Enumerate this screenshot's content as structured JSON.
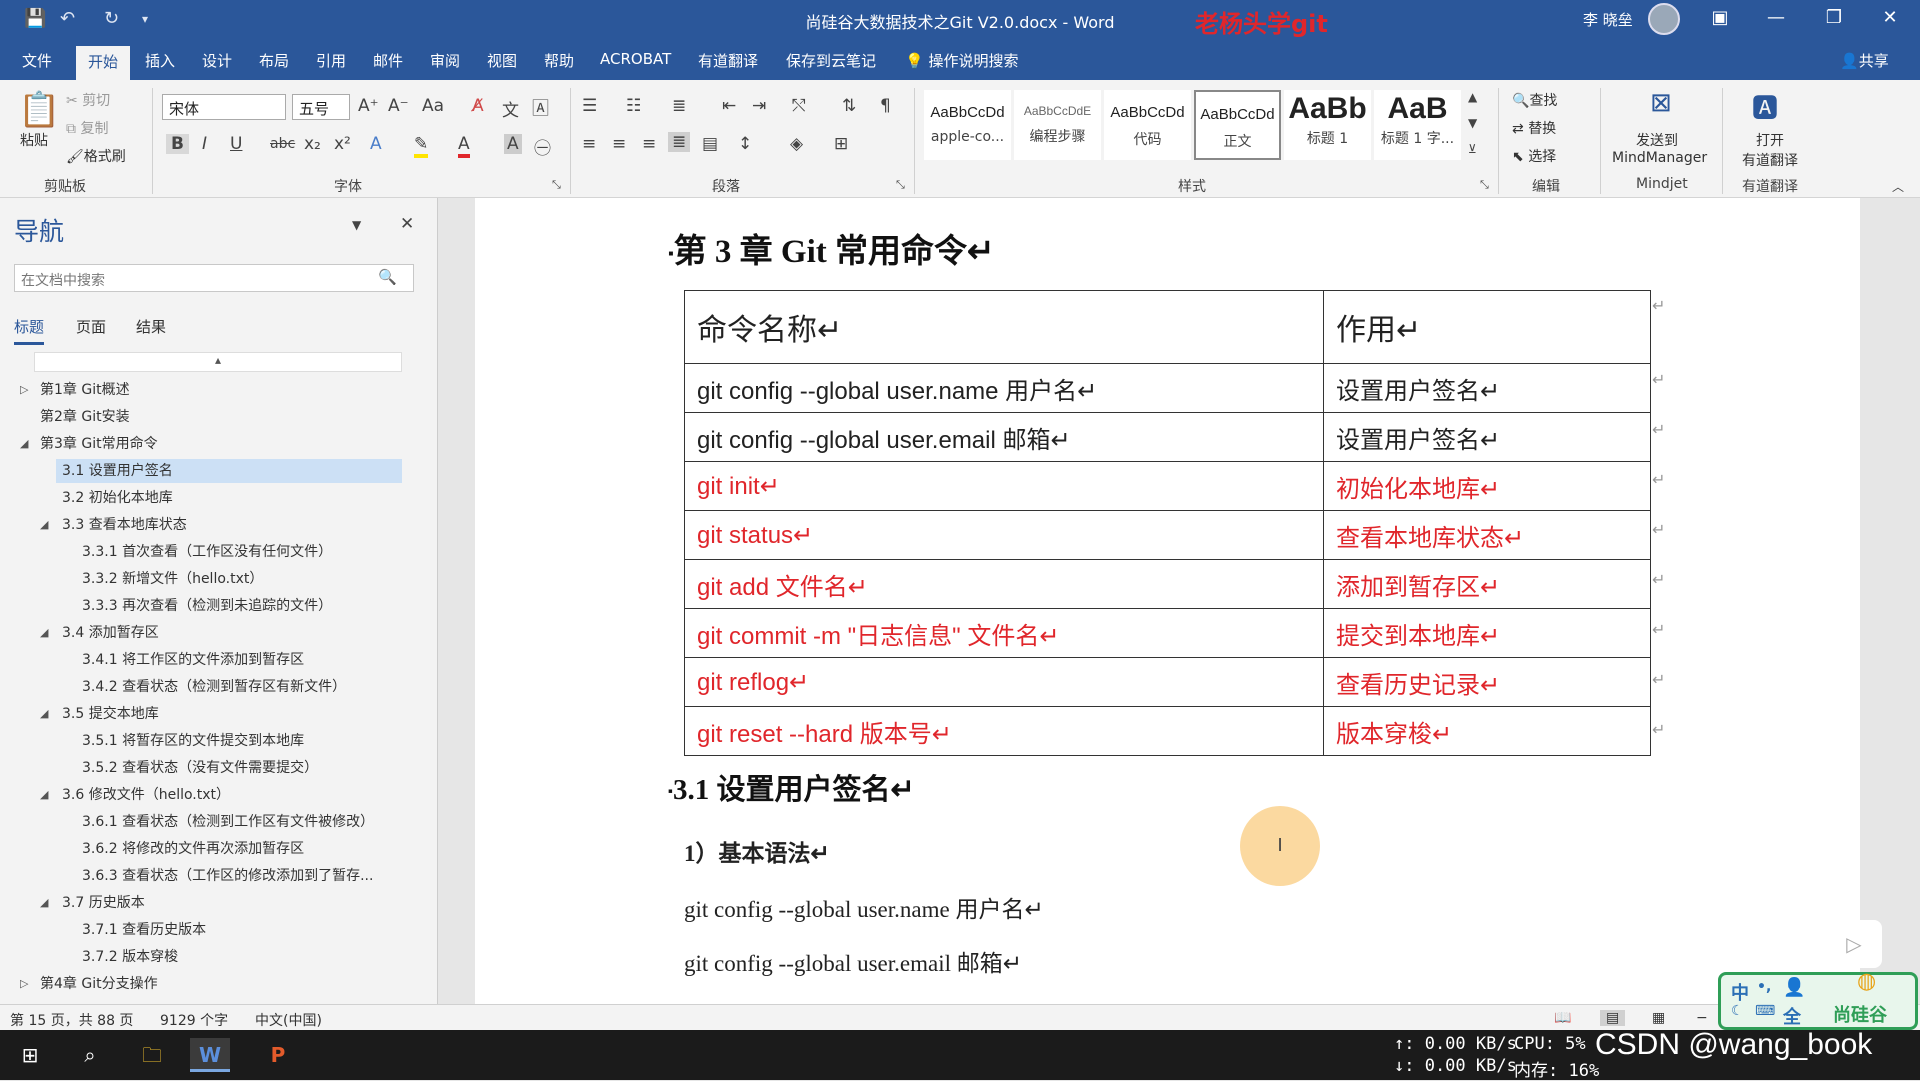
{
  "window": {
    "title": "尚硅谷大数据技术之Git V2.0.docx - Word",
    "overlay": "老杨头学git",
    "user": "李 晓垒"
  },
  "tabs": [
    "文件",
    "开始",
    "插入",
    "设计",
    "布局",
    "引用",
    "邮件",
    "审阅",
    "视图",
    "帮助",
    "ACROBAT",
    "有道翻译",
    "保存到云笔记"
  ],
  "tellme": "操作说明搜索",
  "share": "共享",
  "ribbon": {
    "clipboard": {
      "paste": "粘贴",
      "cut": "剪切",
      "copy": "复制",
      "format": "格式刷",
      "label": "剪贴板"
    },
    "font": {
      "name": "宋体",
      "size": "五号",
      "label": "字体"
    },
    "paragraph": {
      "label": "段落"
    },
    "styles": {
      "label": "样式",
      "items": [
        {
          "prev": "AaBbCcDd",
          "name": "apple-co..."
        },
        {
          "prev": "AaBbCcDdE",
          "name": "编程步骤"
        },
        {
          "prev": "AaBbCcDd",
          "name": "代码"
        },
        {
          "prev": "AaBbCcDd",
          "name": "正文"
        },
        {
          "prev": "AaBb",
          "name": "标题 1"
        },
        {
          "prev": "AaB",
          "name": "标题 1 字..."
        }
      ]
    },
    "editing": {
      "find": "查找",
      "replace": "替换",
      "select": "选择",
      "label": "编辑"
    },
    "mindjet": {
      "btn1": "发送到",
      "btn2": "MindManager",
      "label": "Mindjet"
    },
    "youdao": {
      "btn1": "打开",
      "btn2": "有道翻译",
      "label": "有道翻译"
    }
  },
  "nav": {
    "title": "导航",
    "placeholder": "在文档中搜索",
    "tabs": [
      "标题",
      "页面",
      "结果"
    ],
    "items": [
      "第1章 Git概述",
      "第2章 Git安装",
      "第3章 Git常用命令",
      "3.1 设置用户签名",
      "3.2 初始化本地库",
      "3.3 查看本地库状态",
      "3.3.1 首次查看（工作区没有任何文件）",
      "3.3.2 新增文件（hello.txt）",
      "3.3.3 再次查看（检测到未追踪的文件）",
      "3.4 添加暂存区",
      "3.4.1 将工作区的文件添加到暂存区",
      "3.4.2 查看状态（检测到暂存区有新文件）",
      "3.5 提交本地库",
      "3.5.1 将暂存区的文件提交到本地库",
      "3.5.2 查看状态（没有文件需要提交）",
      "3.6 修改文件（hello.txt）",
      "3.6.1 查看状态（检测到工作区有文件被修改）",
      "3.6.2 将修改的文件再次添加暂存区",
      "3.6.3 查看状态（工作区的修改添加到了暂存...",
      "3.7 历史版本",
      "3.7.1 查看历史版本",
      "3.7.2 版本穿梭",
      "第4章 Git分支操作"
    ]
  },
  "doc": {
    "chapter": "第 3 章  Git 常用命令↵",
    "table_header": [
      "命令名称↵",
      "作用↵"
    ],
    "rows": [
      [
        "git config --global user.name  用户名↵",
        "设置用户签名↵"
      ],
      [
        "git config --global user.email  邮箱↵",
        "设置用户签名↵"
      ],
      [
        "git init↵",
        "初始化本地库↵"
      ],
      [
        "git status↵",
        "查看本地库状态↵"
      ],
      [
        "git add  文件名↵",
        "添加到暂存区↵"
      ],
      [
        "git commit -m \"日志信息\"  文件名↵",
        "提交到本地库↵"
      ],
      [
        "git reflog↵",
        "查看历史记录↵"
      ],
      [
        "git reset --hard  版本号↵",
        "版本穿梭↵"
      ]
    ],
    "section": "3.1  设置用户签名↵",
    "syntax": "1）基本语法↵",
    "line1": "git config --global user.name  用户名↵",
    "line2": "git config --global user.email  邮箱↵"
  },
  "status": {
    "page": "第 15 页，共 88 页",
    "words": "9129 个字",
    "lang": "中文(中国)"
  },
  "taskbar": {
    "net_up": "↑: 0.00 KB/s",
    "net_down": "↓: 0.00 KB/s",
    "cpu": "CPU: 5%",
    "mem": "内存: 16%",
    "csdn": "CSDN @wang_book"
  },
  "ime": {
    "a": "中",
    "b": "全",
    "c": "尚硅谷"
  },
  "colors": {
    "brand": "#2b579a",
    "red": "#e0262b"
  }
}
